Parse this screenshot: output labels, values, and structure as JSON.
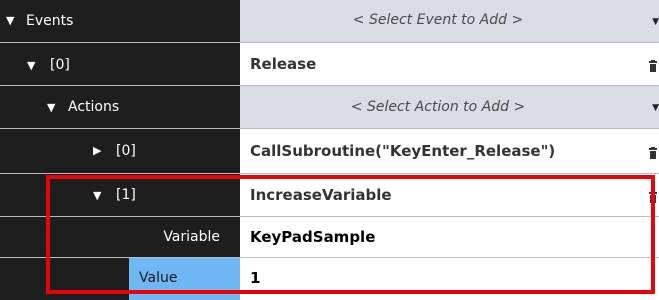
{
  "events": {
    "label": "Events",
    "expand_icon": "triangle-down-icon",
    "select_placeholder": "< Select Event to Add >",
    "item": {
      "index_label": "[0]",
      "value": "Release",
      "actions": {
        "label": "Actions",
        "select_placeholder": "< Select Action to Add >",
        "items": [
          {
            "index_label": "[0]",
            "value": "CallSubroutine(\"KeyEnter_Release\")",
            "state": "collapsed"
          },
          {
            "index_label": "[1]",
            "value": "IncreaseVariable",
            "state": "expanded",
            "properties": {
              "variable": {
                "label": "Variable",
                "value": "KeyPadSample"
              },
              "value": {
                "label": "Value",
                "value": "1"
              }
            }
          }
        ]
      }
    }
  },
  "colors": {
    "tree_bg": "#1e1e1e",
    "tree_text": "#ffffff",
    "dropdown_bg": "#d9dce3",
    "value_text": "#333333",
    "strong_text": "#000000",
    "selected_bg": "#6fb7f5",
    "highlight_border": "#e8000b"
  },
  "icons": [
    "triangle-down-icon",
    "triangle-right-icon",
    "chevron-down-icon",
    "trash-icon"
  ]
}
